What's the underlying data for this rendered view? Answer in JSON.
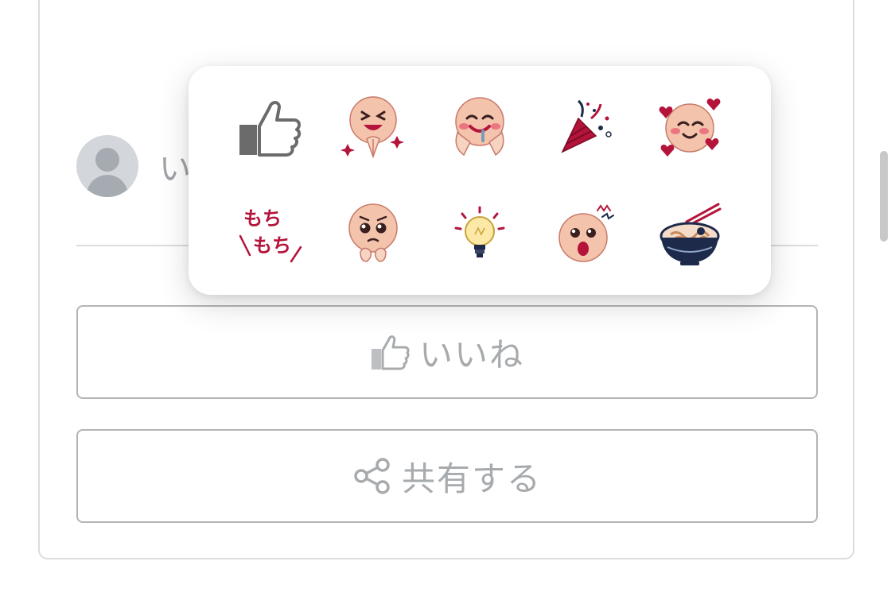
{
  "reader": {
    "partial_text": "い"
  },
  "actions": {
    "like_label": "いいね",
    "share_label": "共有する"
  },
  "reactions": [
    {
      "name": "thumbs-up"
    },
    {
      "name": "laughing-praying-face"
    },
    {
      "name": "drooling-face"
    },
    {
      "name": "party-popper"
    },
    {
      "name": "smiling-face-with-hearts"
    },
    {
      "name": "mochi-mochi-text",
      "text_line1": "もち",
      "text_line2": "もち"
    },
    {
      "name": "pleading-face"
    },
    {
      "name": "light-bulb"
    },
    {
      "name": "surprised-face"
    },
    {
      "name": "udon-bowl"
    }
  ],
  "colors": {
    "accent": "#b4133a",
    "skin": "#f3c3ac",
    "muted_text": "#a8abae",
    "border": "#b4b4b4"
  }
}
